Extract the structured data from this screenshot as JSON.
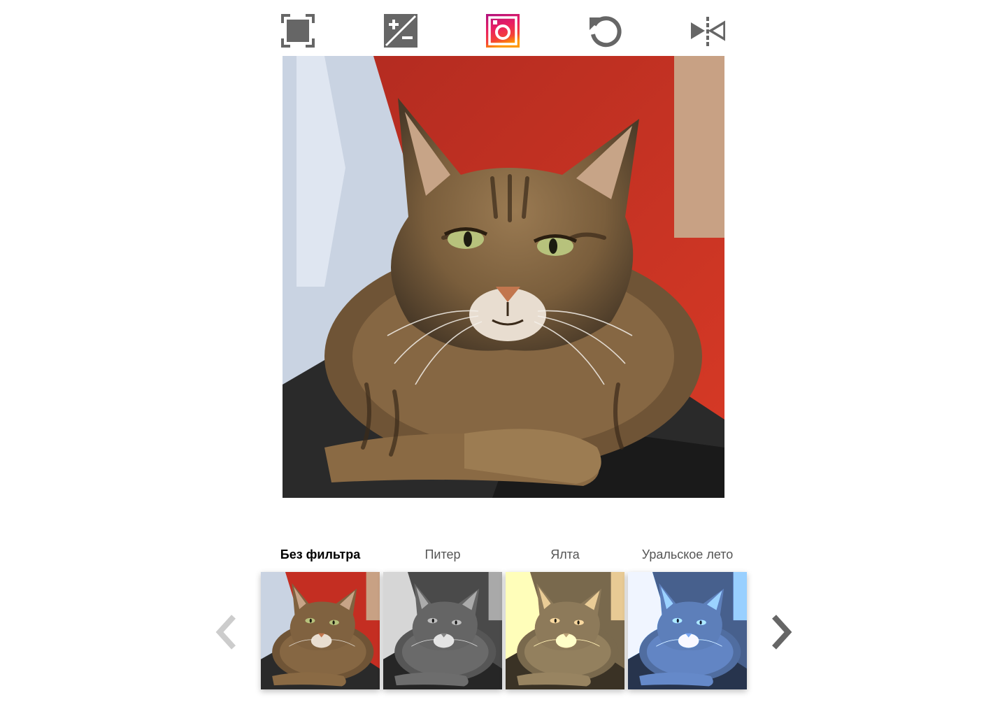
{
  "toolbar": {
    "tools": [
      {
        "id": "crop",
        "icon": "crop-icon"
      },
      {
        "id": "exposure",
        "icon": "exposure-icon"
      },
      {
        "id": "filter",
        "icon": "instagram-filter-icon",
        "active": true
      },
      {
        "id": "rotate",
        "icon": "rotate-icon"
      },
      {
        "id": "flip",
        "icon": "flip-icon"
      }
    ],
    "icon_color": "#666666"
  },
  "filters": {
    "labels": [
      "Без фильтра",
      "Питер",
      "Ялта",
      "Уральское лето"
    ],
    "selected": "Без фильтра",
    "prev_icon": "chevron-left-icon",
    "next_icon": "chevron-right-icon",
    "prev_enabled": false,
    "next_enabled": true
  },
  "colors": {
    "accent_gradient": [
      "#c2185b",
      "#e91e63",
      "#ff9800"
    ],
    "arrow_disabled": "#cccccc",
    "arrow_enabled": "#666666"
  }
}
